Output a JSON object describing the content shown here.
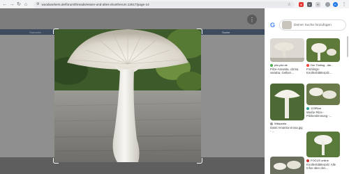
{
  "browser": {
    "url": "woodworkers.de/forum/threads/essen-und-altes-druntherum.12617/page-14",
    "back_icon": "arrow-left",
    "forward_icon": "arrow-right",
    "reload_icon": "reload",
    "home_icon": "home"
  },
  "forum_nav": {
    "left_label": "Startseite",
    "items": [
      "Aktuelles",
      "Galerie",
      "Medienpagen",
      "Mitglieder"
    ],
    "right_label": "Einloggen",
    "search_label": "Suche"
  },
  "lens": {
    "search_placeholder": "Deiner Suche hinzufügen"
  },
  "results": [
    {
      "source": "pilz-pilz.de",
      "title": "Pilze-Amanita, citrina variaba, Gelben..."
    },
    {
      "source": "Der Tintling - die...",
      "title": "Frühlings-Knollenblätterpilz..."
    },
    {
      "source": "123Pilze",
      "title": "Weiße Pilze - Pilzbestimmung -..."
    },
    {
      "source": "Wikipedia",
      "title": "Datei:Amanita virosa.jpg - ..."
    },
    {
      "source": "",
      "title": ""
    },
    {
      "source": "FOCUS online",
      "title": "Knollenblätterpilz: Alle Infos über den..."
    }
  ],
  "colors": {
    "forum_nav_bg": "#3d4b5e",
    "overlay_bg": "#8a8a8a",
    "google_blue": "#4285f4"
  }
}
